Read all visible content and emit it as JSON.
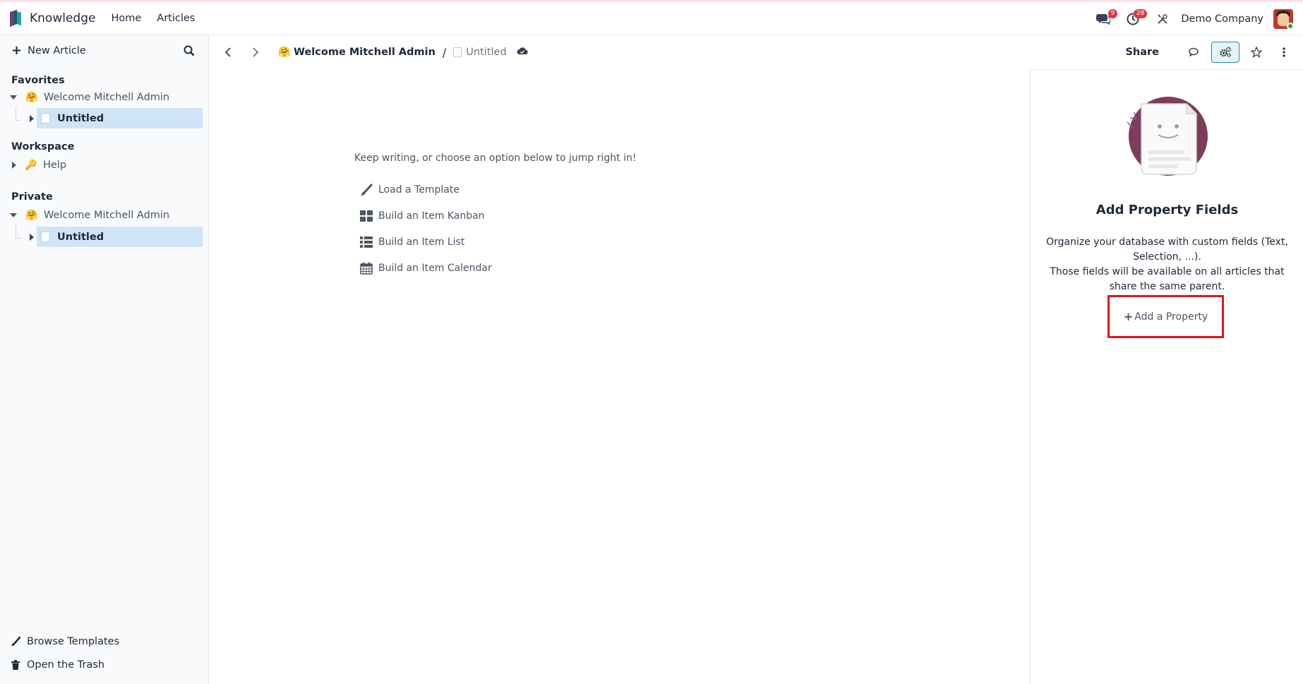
{
  "app": {
    "name": "Knowledge",
    "nav": [
      "Home",
      "Articles"
    ],
    "messages_badge": "9",
    "activities_badge": "28",
    "company": "Demo Company"
  },
  "sidebar": {
    "new_article": "New Article",
    "favorites_title": "Favorites",
    "favorites_parent": "Welcome Mitchell Admin",
    "favorites_child": "Untitled",
    "workspace_title": "Workspace",
    "workspace_item": "Help",
    "private_title": "Private",
    "private_parent": "Welcome Mitchell Admin",
    "private_child": "Untitled",
    "browse_templates": "Browse Templates",
    "open_trash": "Open the Trash"
  },
  "header": {
    "parent_crumb": "Welcome Mitchell Admin",
    "separator": "/",
    "current_crumb": "Untitled",
    "share": "Share"
  },
  "editor": {
    "hint": "Keep writing, or choose an option below to jump right in!",
    "commands": [
      "Load a Template",
      "Build an Item Kanban",
      "Build an Item List",
      "Build an Item Calendar"
    ]
  },
  "properties_panel": {
    "title": "Add Property Fields",
    "desc_line1": "Organize your database with custom fields (Text, Selection, ...).",
    "desc_line2": "Those fields will be available on all articles that share the same parent.",
    "add_button": "Add a Property"
  },
  "colors": {
    "accent": "#2b8a9e",
    "selected_row": "#cfe5f7",
    "highlight_box": "#e3131b",
    "badge": "#dc3545"
  }
}
